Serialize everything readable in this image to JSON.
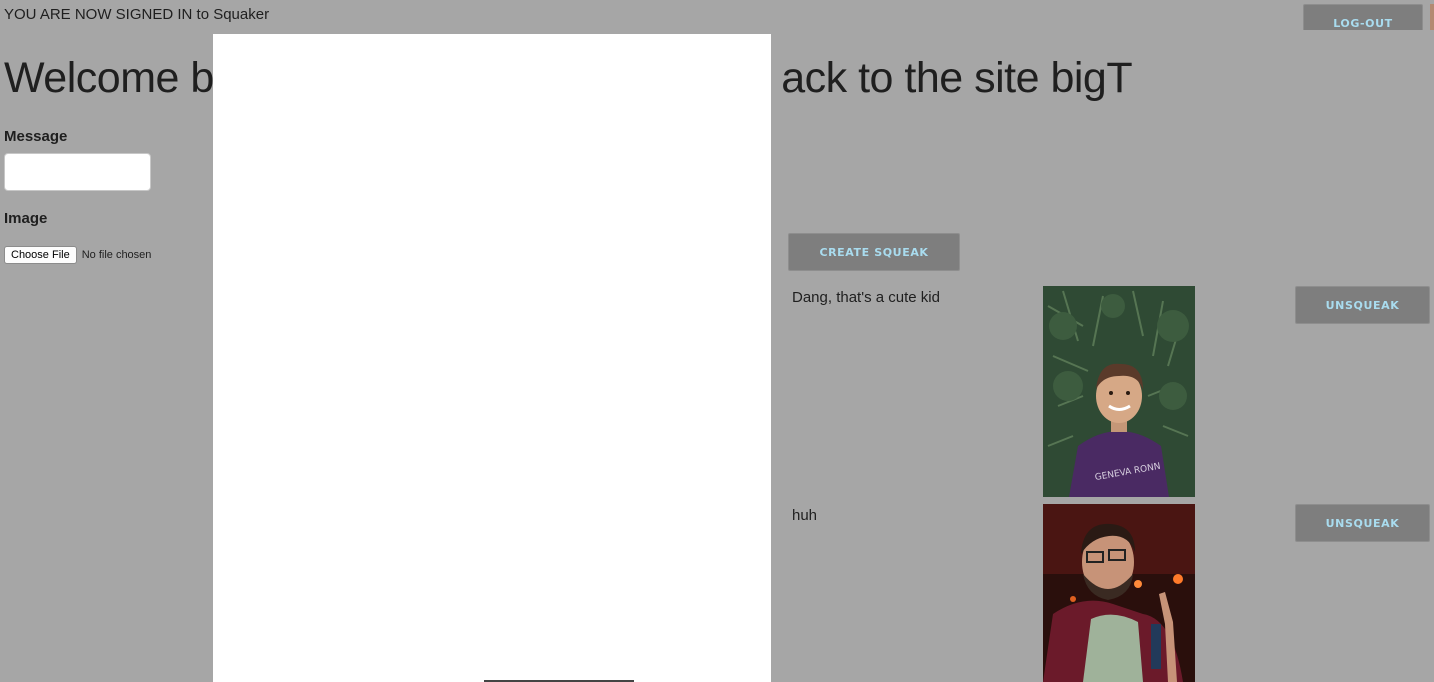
{
  "header": {
    "status": "YOU ARE NOW SIGNED IN to Squaker",
    "logout_label": "LOG-OUT",
    "welcome_left": "Welcome ba",
    "welcome_right": "ack to the site bigT"
  },
  "form": {
    "message_label": "Message",
    "image_label": "Image",
    "choose_file_label": "Choose File",
    "file_status": "No file chosen",
    "create_label": "CREATE SQUEAK"
  },
  "posts": [
    {
      "text": "Dang, that's a cute kid",
      "unsqueak_label": "UNSQUEAK",
      "image": "boy-photo"
    },
    {
      "text": "huh",
      "unsqueak_label": "UNSQUEAK",
      "image": "man-photo"
    }
  ],
  "colors": {
    "background": "#a6a6a6",
    "button_bg": "#7e7e7e",
    "button_text": "#a9dcef",
    "overlay": "#ffffff"
  }
}
